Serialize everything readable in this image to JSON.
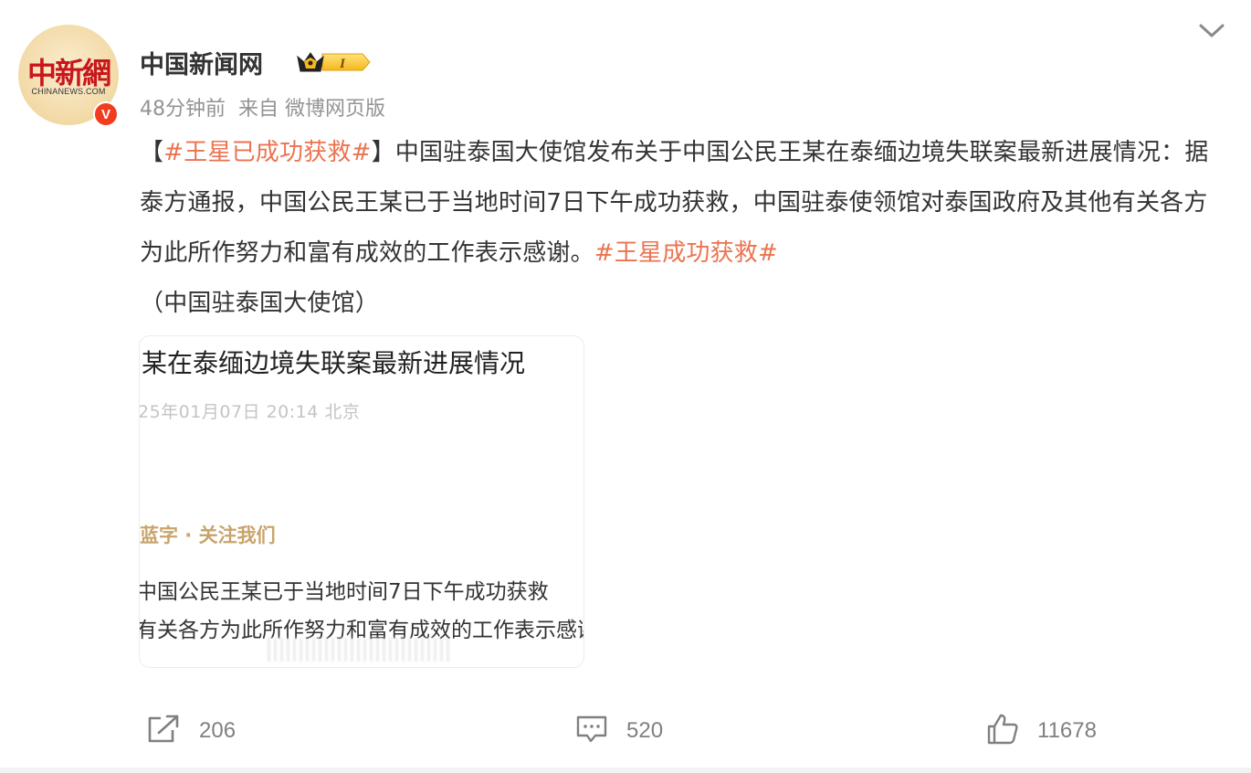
{
  "author": {
    "name": "中国新闻网",
    "avatar_logo_text": "中新網",
    "avatar_sub_text": "CHINANEWS.COM",
    "verified_mark": "V",
    "rank_badge_label": "I"
  },
  "meta": {
    "time": "48分钟前",
    "source": "来自 微博网页版"
  },
  "post": {
    "bracket_open": "【",
    "hashtag_1": "#王星已成功获救#",
    "bracket_close": "】",
    "body": "中国驻泰国大使馆发布关于中国公民王某在泰缅边境失联案最新进展情况：据泰方通报，中国公民王某已于当地时间7日下午成功获救，中国驻泰使领馆对泰国政府及其他有关各方为此所作努力和富有成效的工作表示感谢。",
    "hashtag_2": "#王星成功获救#",
    "source_note": "（中国驻泰国大使馆）"
  },
  "card": {
    "title": "某在泰缅边境失联案最新进展情况",
    "date_line": "25年01月07日 20:14  北京",
    "follow_line": "蓝字 · 关注我们",
    "line1": "中国公民王某已于当地时间7日下午成功获救",
    "line2": "有关各方为此所作努力和富有成效的工作表示感谢"
  },
  "actions": {
    "repost_count": "206",
    "comment_count": "520",
    "like_count": "11678"
  },
  "colors": {
    "hashtag": "#eb7350",
    "meta_gray": "#939393",
    "verified_red": "#f23c1f",
    "logo_red": "#c8161d",
    "crown_gold": "#f5b81c"
  },
  "icons": {
    "expand": "chevron-down-icon",
    "repost": "repost-icon",
    "comment": "comment-icon",
    "like": "thumbs-up-icon",
    "rank": "crown-badge-icon"
  }
}
